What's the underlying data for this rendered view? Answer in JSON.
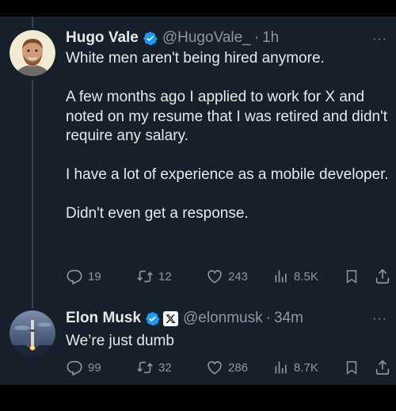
{
  "tweets": [
    {
      "display_name": "Hugo Vale",
      "handle": "@HugoVale_",
      "separator": "·",
      "time": "1h",
      "more_label": "···",
      "text": "White men aren't being hired anymore.\n\nA few months ago I applied to work for X and noted on my resume that I was retired and didn't require any salary.\n\nI have a lot of experience as a mobile developer.\n\nDidn't even get a response.",
      "replies": "19",
      "retweets": "12",
      "likes": "243",
      "views": "8.5K"
    },
    {
      "display_name": "Elon Musk",
      "handle": "@elonmusk",
      "separator": "·",
      "time": "34m",
      "more_label": "···",
      "text": "We’re just dumb",
      "replies": "99",
      "retweets": "32",
      "likes": "286",
      "views": "8.7K"
    }
  ],
  "colors": {
    "background": "#15202b",
    "text": "#e7e9ea",
    "muted": "#8b98a5",
    "verified": "#1d9bf0",
    "thread_line": "#38444d"
  }
}
